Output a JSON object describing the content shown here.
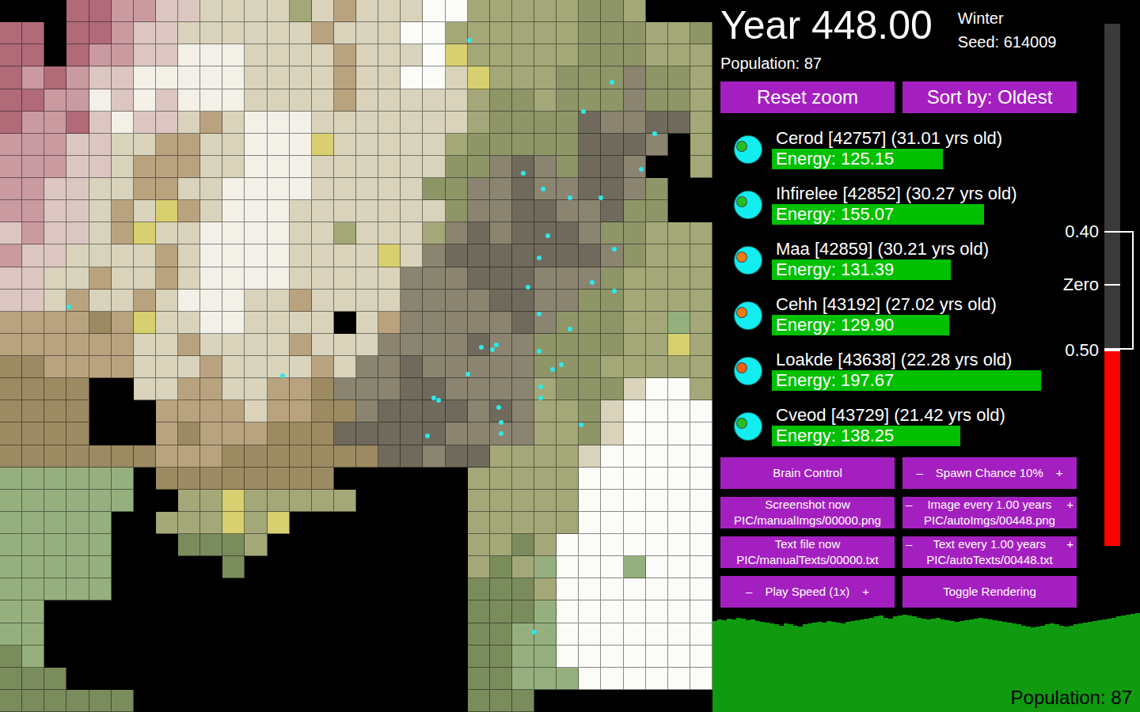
{
  "header": {
    "year": "Year 448.00",
    "season": "Winter",
    "seed": "Seed: 614009",
    "population": "Population: 87"
  },
  "top_buttons": [
    "Reset zoom",
    "Sort by: Oldest"
  ],
  "creatures_list": [
    {
      "name": "Cerod [42757] (31.01 yrs old)",
      "energy": "Energy: 125.15",
      "level": 0.54,
      "color": "#22c022"
    },
    {
      "name": "Ihfirelee [42852] (30.27 yrs old)",
      "energy": "Energy: 155.07",
      "level": 0.67,
      "color": "#22c022"
    },
    {
      "name": "Maa [42859] (30.21 yrs old)",
      "energy": "Energy: 131.39",
      "level": 0.565,
      "color": "#f07a10"
    },
    {
      "name": "Cehh [43192] (27.02 yrs old)",
      "energy": "Energy: 129.90",
      "level": 0.56,
      "color": "#f07a10"
    },
    {
      "name": "Loakde [43638] (22.28 yrs old)",
      "energy": "Energy: 197.67",
      "level": 0.85,
      "color": "#f06010"
    },
    {
      "name": "Cveod [43729] (21.42 yrs old)",
      "energy": "Energy: 138.25",
      "level": 0.595,
      "color": "#22c022"
    }
  ],
  "controls": [
    {
      "kind": "plain",
      "label": "Brain Control",
      "sub": "",
      "minus": "",
      "plus": ""
    },
    {
      "kind": "stepper",
      "label": "Spawn Chance 10%",
      "sub": "",
      "minus": "–",
      "plus": "+"
    },
    {
      "kind": "plain",
      "label": "Screenshot now",
      "sub": "PIC/manualImgs/00000.png",
      "minus": "",
      "plus": ""
    },
    {
      "kind": "stepper",
      "label": "Image every 1.00 years",
      "sub": "PIC/autoImgs/00448.png",
      "minus": "–",
      "plus": "+"
    },
    {
      "kind": "plain",
      "label": "Text file now",
      "sub": "PIC/manualTexts/00000.txt",
      "minus": "",
      "plus": ""
    },
    {
      "kind": "stepper",
      "label": "Text every 1.00 years",
      "sub": "PIC/autoTexts/00448.txt",
      "minus": "–",
      "plus": "+"
    },
    {
      "kind": "stepper",
      "label": "Play Speed (1x)",
      "sub": "",
      "minus": "–",
      "plus": "+"
    },
    {
      "kind": "plain",
      "label": "Toggle Rendering",
      "sub": "",
      "minus": "",
      "plus": ""
    }
  ],
  "thermometer": {
    "level": 0.374,
    "ticks": [
      {
        "label": "0.40",
        "level": 0.6015
      },
      {
        "label": "Zero",
        "level": 0.5
      },
      {
        "label": "0.50",
        "level": 0.374
      }
    ],
    "range": {
      "high": 0.6015,
      "low": 0.374
    }
  },
  "population_chart": {
    "label": "Population: 87",
    "values": [
      104,
      106,
      105,
      107,
      106,
      108,
      107,
      105,
      106,
      104,
      103,
      102,
      101,
      100,
      99,
      101,
      100,
      99,
      98,
      100,
      101,
      102,
      103,
      102,
      104,
      103,
      102,
      101,
      103,
      104,
      105,
      106,
      107,
      108,
      109,
      110,
      108,
      107,
      109,
      110,
      111,
      110,
      109,
      108,
      107,
      106,
      107,
      108,
      106,
      105,
      104,
      103,
      104,
      105,
      106,
      107,
      108,
      107,
      106,
      105,
      104,
      103,
      102,
      101,
      100,
      99,
      98,
      97,
      98,
      99,
      100,
      101,
      100,
      99,
      98,
      99,
      100,
      101,
      102,
      103,
      104,
      105,
      106,
      107,
      108,
      109,
      110,
      111,
      112,
      113
    ]
  },
  "map": {
    "palette": {
      "k": "#000000",
      "r": "#b06a78",
      "p": "#c99aa0",
      "q": "#dcc6c2",
      "w": "#f3f0e8",
      "c": "#d9d3bc",
      "t": "#b9a37f",
      "b": "#9c8a62",
      "o": "#a4a878",
      "O": "#8e9668",
      "g": "#7a8c5c",
      "G": "#95b07e",
      "d": "#6f6a5c",
      "m": "#8a8470",
      "W": "#fbfbf8",
      "y": "#d8cf70"
    },
    "rows": [
      "kkkrrppqqccccoctcccWWoooooOOokkk",
      "rrkrrpqqcccccctcccWWooooooOOOooO",
      "rrkrppqqwwwcccctcccWyoooooOOOooo",
      "rprpqqwwwwwcccctccWWcyoooOOOmOOo",
      "rrppwqwqwwwcccctcccccoOOoOOOmOOo",
      "rpprqwqqctcwwwcccccccoOOOOdmmddo",
      "pppqqccttccwwwycccccoOOOOOdddmko",
      "pppqqctttccwwwccccccOOmdmOddmkko",
      "ppqqccttccwwwwcccccOOmmdmmddmOkk",
      "ppqqctcytcwwwcccccccOmmddmmdOOkk",
      "qpqqctyccwwwwccocccomdmdddmOOooo",
      "pqqcccctcwwwwccccycmdddddddmOooo",
      "qqcctcctcwwwwcccccmmmdddmmmOoooo",
      "qqctcctcwwwcctccccmmmmddmmOOoooo",
      "ttttbtyccwwccccცctmmmmmdmOOOooGo",
      "ttttttcctcccctcccmmmmdmmOOOOooyo",
      "bbttttccctcccctcmmdmmmmmOOOooooo",
      "bbbbkkccttccttbmmmddmmmmoOOOcWWo",
      "bbbbkkkttttcttbbmddddmdmooOcWWWW",
      "bbbbkkktbtttbbbdddddmmmmooOcWWWW",
      "bbbbbbbtttbbbbbbbddmddoooocWWWWW",
      "GGGGGGkbbbbbbbbkkkkkkoooooWWWWWW",
      "GGGGGGkkooyoooookkkkkoooooWWWWWW",
      "GGGGGkkoooyoykkkkkkkkoooooWWWWWW",
      "GGGGGkkkgggokkkkkkkkkoogoWWWWWWW",
      "GGGGGkkkkkgkkkkkkkkkkogoGWWWGWWW",
      "GGGGGkkkkkkkkkkkkkkkkgggoWWWWWWW",
      "GGkkkkkkkkkkkkkkkkkkkgggGWWWWWWW",
      "GGkkkkkkkkkkkkkkkkkkkggGGWWWWWWW",
      "gGkkkkkkkkkkkkkkkkkkkggGGWWWWWWW",
      "gggkkkkkkkkkkkkkkkkkkggGGGWWWWWW",
      "ggggggkkkkkkkkkkkkkkkgggkkkkkkkk"
    ],
    "creatures": [
      {
        "x": 21.1,
        "y": 1.8
      },
      {
        "x": 27.5,
        "y": 3.7
      },
      {
        "x": 26.2,
        "y": 5.0
      },
      {
        "x": 29.4,
        "y": 6.0
      },
      {
        "x": 28.8,
        "y": 7.6
      },
      {
        "x": 23.5,
        "y": 7.8
      },
      {
        "x": 24.4,
        "y": 8.5
      },
      {
        "x": 25.6,
        "y": 8.9
      },
      {
        "x": 27.0,
        "y": 8.9
      },
      {
        "x": 24.6,
        "y": 10.6
      },
      {
        "x": 24.2,
        "y": 11.6
      },
      {
        "x": 27.6,
        "y": 11.2
      },
      {
        "x": 26.6,
        "y": 12.7
      },
      {
        "x": 23.7,
        "y": 12.9
      },
      {
        "x": 27.6,
        "y": 13.1
      },
      {
        "x": 3.1,
        "y": 13.8
      },
      {
        "x": 24.2,
        "y": 14.1
      },
      {
        "x": 25.6,
        "y": 14.8
      },
      {
        "x": 21.6,
        "y": 15.6
      },
      {
        "x": 22.1,
        "y": 15.7
      },
      {
        "x": 22.3,
        "y": 15.5
      },
      {
        "x": 24.2,
        "y": 15.8
      },
      {
        "x": 25.2,
        "y": 16.4
      },
      {
        "x": 24.8,
        "y": 16.6
      },
      {
        "x": 21.0,
        "y": 16.8
      },
      {
        "x": 12.7,
        "y": 16.9
      },
      {
        "x": 24.3,
        "y": 17.4
      },
      {
        "x": 19.5,
        "y": 17.9
      },
      {
        "x": 19.7,
        "y": 18.0
      },
      {
        "x": 24.3,
        "y": 17.9
      },
      {
        "x": 22.4,
        "y": 18.3
      },
      {
        "x": 22.5,
        "y": 19.0
      },
      {
        "x": 22.5,
        "y": 19.5
      },
      {
        "x": 19.2,
        "y": 19.6
      },
      {
        "x": 26.1,
        "y": 19.1
      },
      {
        "x": 24.0,
        "y": 28.4
      }
    ]
  }
}
